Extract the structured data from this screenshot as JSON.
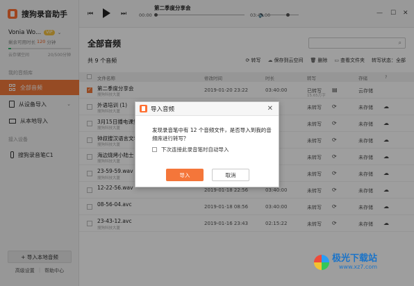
{
  "app": {
    "name": "搜狗录音助手"
  },
  "user": {
    "name": "Vonia Wo...",
    "vip_label": "VIP",
    "quota_prefix": "剩余可用时长",
    "quota_value": "120",
    "quota_unit": "分钟",
    "storage_label": "云存储空间",
    "storage_value": "20/500分钟",
    "storage_fraction": 0.04
  },
  "sidebar": {
    "section_library": "我的音频库",
    "items": [
      {
        "label": "全部音频",
        "active": true
      },
      {
        "label": "从设备导入"
      },
      {
        "label": "从本地导入"
      }
    ],
    "section_devices": "接入设备",
    "device": "搜狗录音笔C1",
    "import_local_button": "+ 导入本地音频",
    "advanced_settings": "高级设置",
    "help_center": "帮助中心"
  },
  "player": {
    "title": "第二季度分享会",
    "time_start": "00:00",
    "time_end": "03:40:00"
  },
  "main": {
    "title": "全部音频",
    "count_label": "共 9 个音频",
    "toolbar": {
      "transcribe": "转写",
      "save_cloud": "保存到云空间",
      "delete": "删除",
      "view_folder": "查看文件夹",
      "status_filter": "转写状态：全部"
    },
    "columns": {
      "name": "文件名称",
      "time": "修改时间",
      "duration": "时长",
      "transcribe": "转写",
      "storage": "存储"
    },
    "rows": [
      {
        "name": "第二季度分享会",
        "sub": "搜狗科技大厦",
        "date": "2019-01-20  23:22",
        "duration": "03:40:00",
        "trans": "已转写",
        "trans_sub": "15.65万字",
        "store": "云存储",
        "checked": true
      },
      {
        "name": "外语培训 (1)",
        "sub": "搜狗科技大厦",
        "date": "",
        "duration": "",
        "trans": "未转写",
        "trans_sub": "",
        "store": "未存储",
        "checked": false
      },
      {
        "name": "3月15日播电课堂",
        "sub": "搜狗科技大厦",
        "date": "",
        "duration": "",
        "trans": "未转写",
        "trans_sub": "",
        "store": "未存储",
        "checked": false
      },
      {
        "name": "钟叔搜汉语言文学",
        "sub": "搜狗科技大厦",
        "date": "",
        "duration": "",
        "trans": "未转写",
        "trans_sub": "",
        "store": "未存储",
        "checked": false
      },
      {
        "name": "海边烧烤小陆士",
        "sub": "搜狗科技大厦",
        "date": "",
        "duration": "",
        "trans": "未转写",
        "trans_sub": "",
        "store": "未存储",
        "checked": false
      },
      {
        "name": "23-59-59.wav",
        "sub": "搜狗科技大厦",
        "date": "",
        "duration": "",
        "trans": "未转写",
        "trans_sub": "",
        "store": "未存储",
        "checked": false
      },
      {
        "name": "12-22-56.wav",
        "sub": "",
        "date": "2019-01-18  22:56",
        "duration": "03:40:00",
        "trans": "未转写",
        "trans_sub": "",
        "store": "未存储",
        "checked": false
      },
      {
        "name": "08-56-04.avc",
        "sub": "",
        "date": "2019-01-18  08:56",
        "duration": "03:40:00",
        "trans": "未转写",
        "trans_sub": "",
        "store": "未存储",
        "checked": false
      },
      {
        "name": "23-43-12.avc",
        "sub": "搜狗科技大厦",
        "date": "2019-01-16  23:43",
        "duration": "02:15:22",
        "trans": "未转写",
        "trans_sub": "",
        "store": "未存储",
        "checked": false
      }
    ]
  },
  "dialog": {
    "title": "导入音频",
    "message": "发现录音笔中有 12 个音频文件，是否导入到我的音频库进行转写？",
    "checkbox_label": "下次连接此录音笔时自动导入",
    "ok": "导入",
    "cancel": "取消"
  },
  "watermark": {
    "main": "极光下载站",
    "sub": "www.xz7.com"
  }
}
